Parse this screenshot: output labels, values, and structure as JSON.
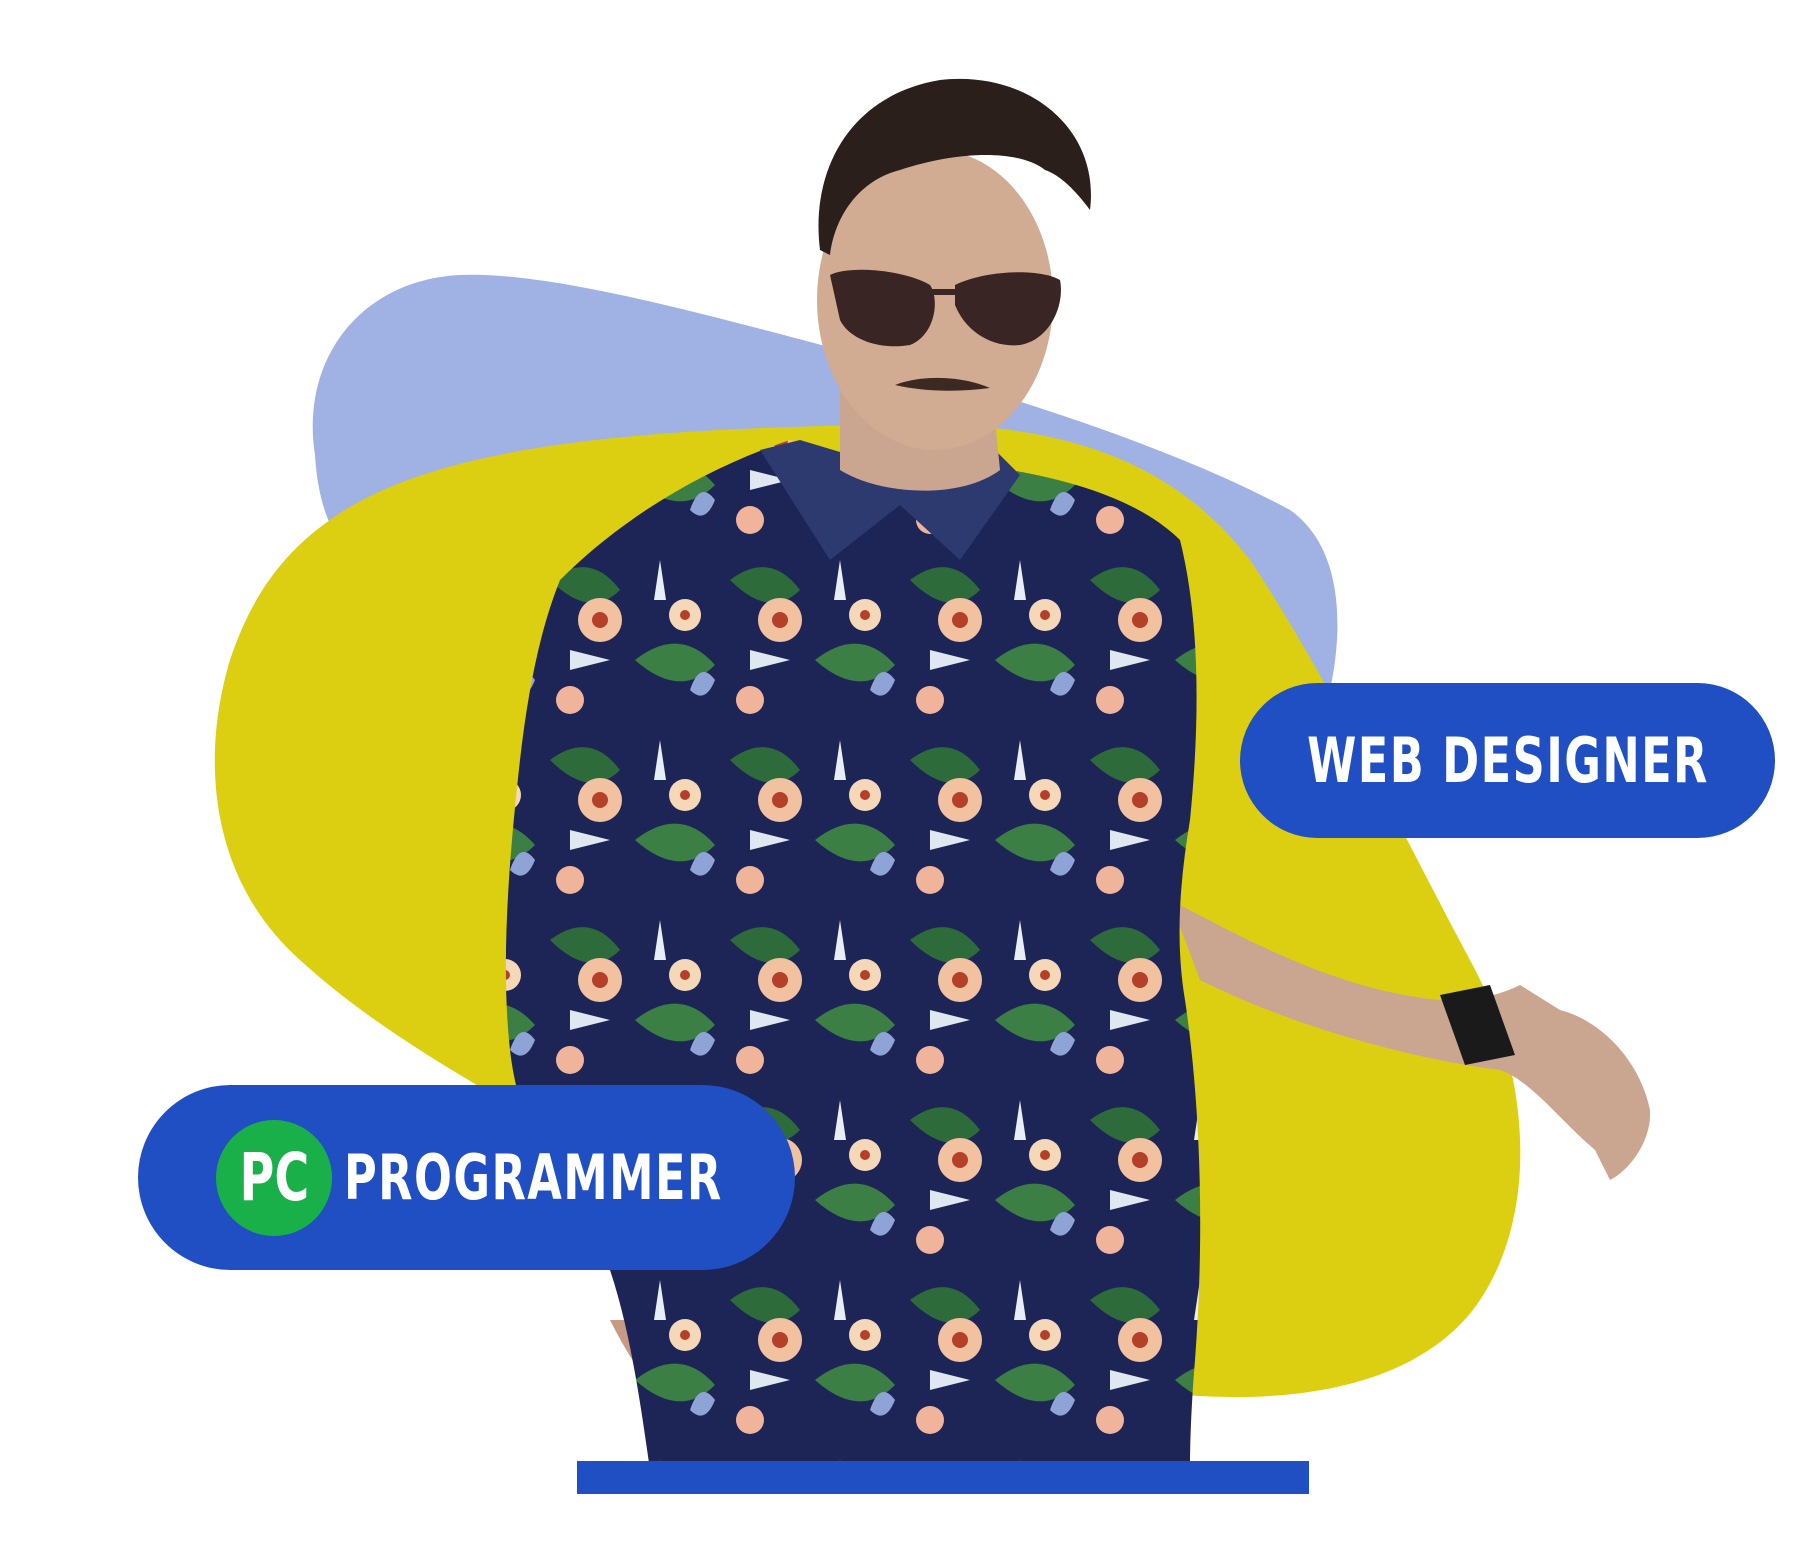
{
  "image": {
    "subject": "person",
    "colors": {
      "background": "#ffffff",
      "blob_periwinkle": "#9fb2e3",
      "blob_yellow": "#dccf12",
      "pill_blue": "#1f4fc3",
      "icon_green": "#19b04a",
      "shirt_navy": "#1d2456"
    }
  },
  "badges": {
    "web_designer": "WEB DESIGNER",
    "programmer": "PROGRAMMER",
    "programmer_icon_text": "PC"
  },
  "icons": {
    "programmer_icon": "pc-circle-icon"
  }
}
